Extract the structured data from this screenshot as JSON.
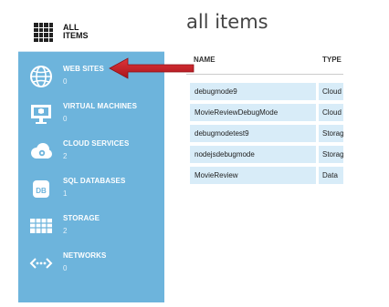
{
  "sidebar": {
    "header": {
      "label": "ALL ITEMS"
    },
    "items": [
      {
        "label": "WEB SITES",
        "count": "0",
        "icon": "globe-icon"
      },
      {
        "label": "VIRTUAL MACHINES",
        "count": "0",
        "icon": "monitor-icon"
      },
      {
        "label": "CLOUD SERVICES",
        "count": "2",
        "icon": "cloud-gear-icon"
      },
      {
        "label": "SQL DATABASES",
        "count": "1",
        "icon": "database-icon"
      },
      {
        "label": "STORAGE",
        "count": "2",
        "icon": "table-icon"
      },
      {
        "label": "NETWORKS",
        "count": "0",
        "icon": "network-icon"
      }
    ]
  },
  "main": {
    "title": "all items",
    "columns": {
      "name": "NAME",
      "type": "TYPE"
    },
    "rows": [
      {
        "name": "debugmode9",
        "type": "Cloud"
      },
      {
        "name": "MovieReviewDebugMode",
        "type": "Cloud"
      },
      {
        "name": "debugmodetest9",
        "type": "Storage"
      },
      {
        "name": "nodejsdebugmode",
        "type": "Storage"
      },
      {
        "name": "MovieReview",
        "type": "Data"
      }
    ]
  },
  "colors": {
    "sidebar_bg": "#6db4dc",
    "row_highlight": "#d8ecf8",
    "arrow": "#c8202a"
  }
}
